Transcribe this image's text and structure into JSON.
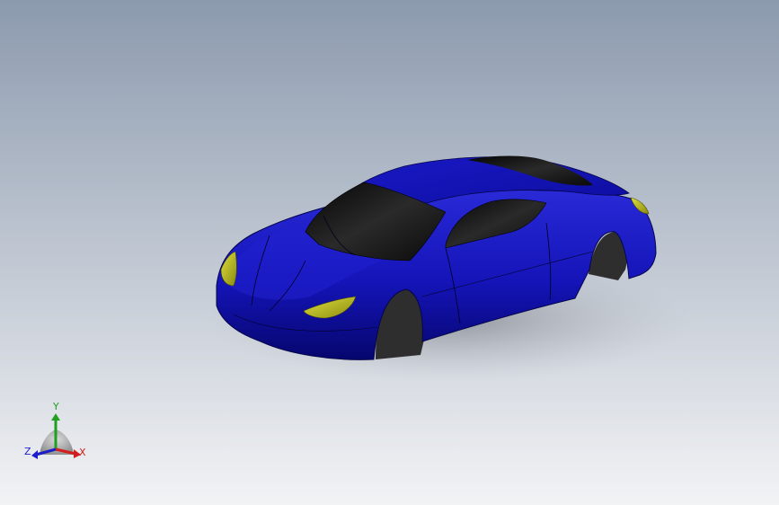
{
  "viewport": {
    "background_top": "#8c9aae",
    "background_bottom": "#f2f3f5"
  },
  "model": {
    "body_color": "#1212b4",
    "body_highlight": "#3c3cf0",
    "glass_color": "#111111",
    "light_color": "#c8c81e",
    "tire_color": "#3a3a3a",
    "shadow_color": "#9a9ea6"
  },
  "triad": {
    "x_label": "X",
    "y_label": "Y",
    "z_label": "Z",
    "x_color": "#d21e1e",
    "y_color": "#20a020",
    "z_color": "#1e1ec8"
  }
}
